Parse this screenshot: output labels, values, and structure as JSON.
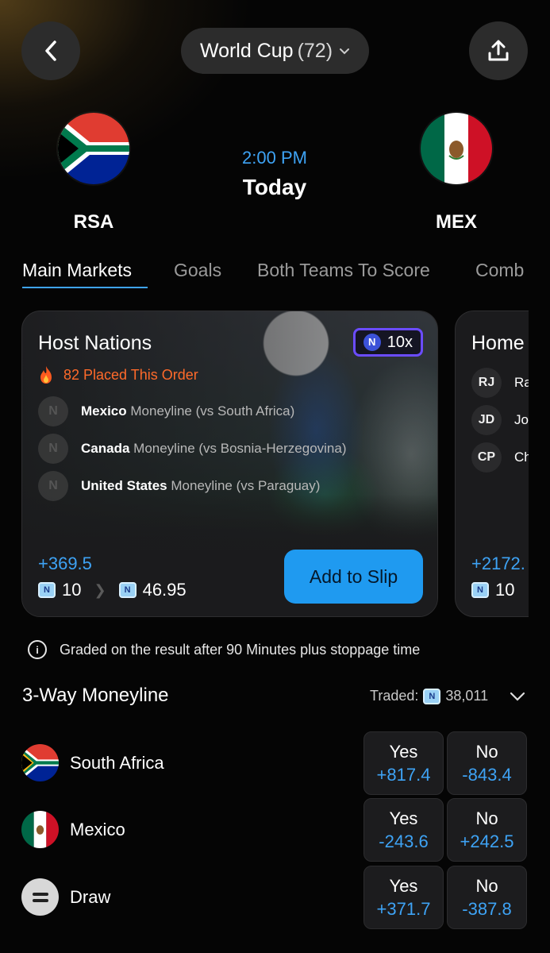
{
  "header": {
    "competition": "World Cup",
    "count": "(72)"
  },
  "match": {
    "home_code": "RSA",
    "away_code": "MEX",
    "time": "2:00 PM",
    "day": "Today"
  },
  "tabs": [
    "Main Markets",
    "Goals",
    "Both Teams To Score",
    "Comb"
  ],
  "cards": [
    {
      "title": "Host Nations",
      "multiplier": "10x",
      "placed": "82 Placed This Order",
      "legs": [
        {
          "team": "Mexico",
          "detail": "Moneyline (vs South Africa)"
        },
        {
          "team": "Canada",
          "detail": "Moneyline (vs Bosnia-Herzegovina)"
        },
        {
          "team": "United States",
          "detail": "Moneyline (vs Paraguay)"
        }
      ],
      "odds": "+369.5",
      "stake": "10",
      "payout": "46.95",
      "button": "Add to Slip"
    },
    {
      "title": "Home",
      "legs": [
        {
          "initials": "RJ",
          "text": "Ra"
        },
        {
          "initials": "JD",
          "text": "Jo"
        },
        {
          "initials": "CP",
          "text": "Ch"
        }
      ],
      "odds": "+2172.",
      "stake": "10"
    }
  ],
  "info_text": "Graded on the result after 90 Minutes plus stoppage time",
  "moneyline": {
    "title": "3-Way Moneyline",
    "traded_label": "Traded:",
    "traded_value": "38,011",
    "rows": [
      {
        "label": "South Africa",
        "yes_label": "Yes",
        "yes_price": "+817.4",
        "no_label": "No",
        "no_price": "-843.4"
      },
      {
        "label": "Mexico",
        "yes_label": "Yes",
        "yes_price": "-243.6",
        "no_label": "No",
        "no_price": "+242.5"
      },
      {
        "label": "Draw",
        "yes_label": "Yes",
        "yes_price": "+371.7",
        "no_label": "No",
        "no_price": "-387.8"
      }
    ]
  },
  "colors": {
    "accent_blue": "#3ea3f5",
    "button_blue": "#1f9af0",
    "placed_orange": "#ff6a2a",
    "badge_purple": "#6b4cff"
  },
  "icons": [
    "back-chevron-icon",
    "share-icon",
    "chevron-down-icon",
    "fire-icon",
    "info-icon",
    "coin-icon"
  ]
}
